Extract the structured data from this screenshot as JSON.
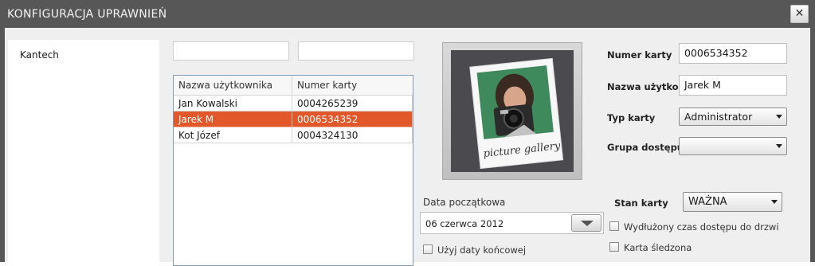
{
  "window": {
    "title": "KONFIGURACJA UPRAWNIEŃ",
    "close_icon": "close-icon"
  },
  "sidebar": {
    "items": [
      {
        "label": "Kantech"
      }
    ]
  },
  "search": {
    "field1_value": "",
    "field2_value": ""
  },
  "users_table": {
    "columns": [
      "Nazwa użytkownika",
      "Numer karty"
    ],
    "rows": [
      {
        "name": "Jan Kowalski",
        "card": "0004265239",
        "selected": false
      },
      {
        "name": "Jarek M",
        "card": "0006534352",
        "selected": true
      },
      {
        "name": "Kot Józef",
        "card": "0004324130",
        "selected": false
      }
    ],
    "selected_color": "#e2582b"
  },
  "photo": {
    "caption": "picture gallery"
  },
  "details": {
    "card_number_label": "Numer karty",
    "card_number_value": "0006534352",
    "username_label": "Nazwa użytkow.",
    "username_value": "Jarek M",
    "card_type_label": "Typ karty",
    "card_type_value": "Administrator",
    "access_group_label": "Grupa dostępu",
    "access_group_value": "",
    "card_state_label": "Stan karty",
    "card_state_value": "WAŻNA"
  },
  "dates": {
    "start_label": "Data początkowa",
    "start_value": "06 czerwca 2012",
    "use_end_date_label": "Użyj daty końcowej",
    "use_end_date_checked": false
  },
  "options": {
    "extended_access_label": "Wydłużony czas dostępu do drzwi",
    "extended_access_checked": false,
    "tracked_card_label": "Karta śledzona",
    "tracked_card_checked": false
  }
}
